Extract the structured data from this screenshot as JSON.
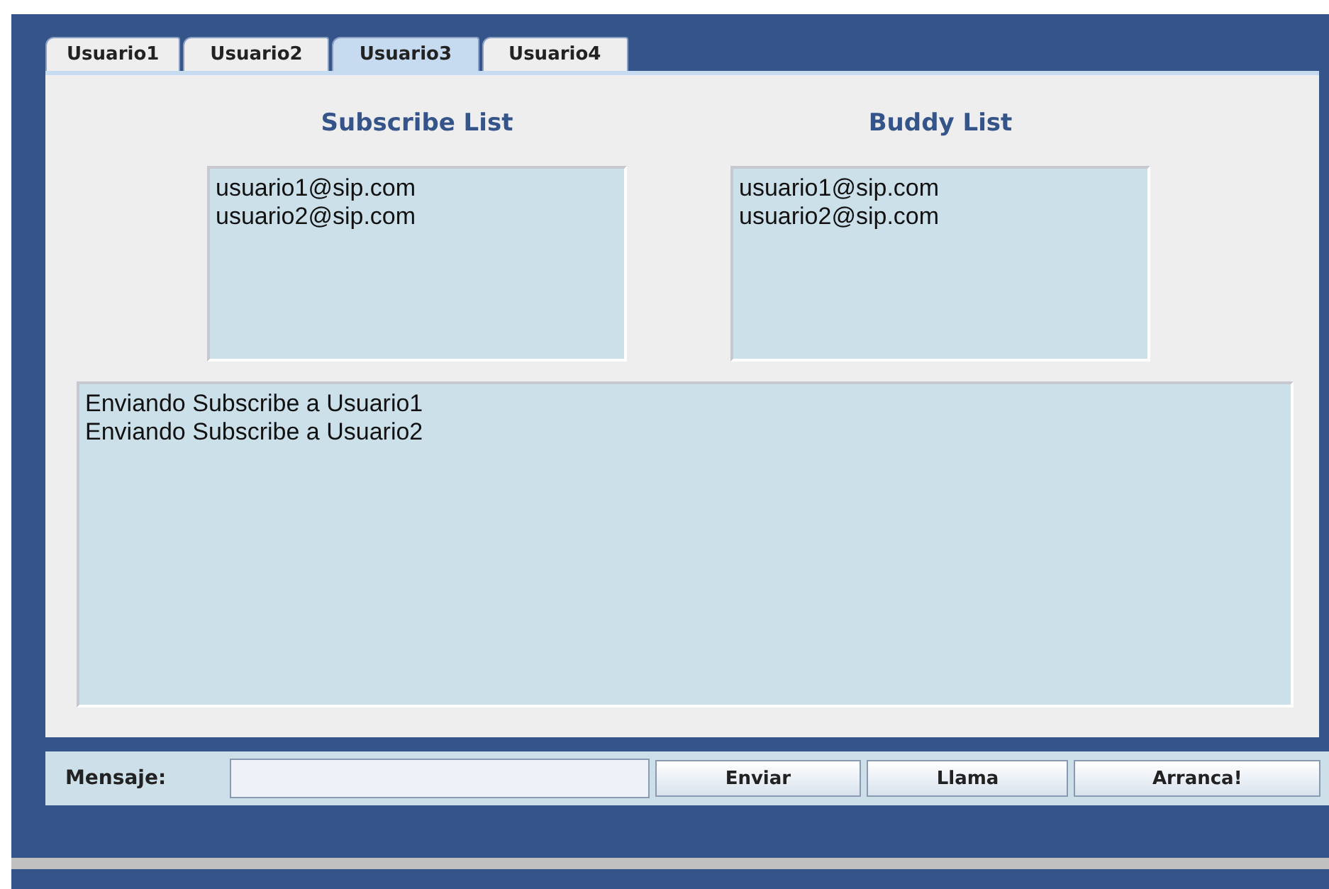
{
  "tabs": [
    {
      "label": "Usuario1",
      "selected": false
    },
    {
      "label": "Usuario2",
      "selected": false
    },
    {
      "label": "Usuario3",
      "selected": true
    },
    {
      "label": "Usuario4",
      "selected": false
    }
  ],
  "subscribe_list": {
    "title": "Subscribe List",
    "items": [
      "usuario1@sip.com",
      "usuario2@sip.com"
    ]
  },
  "buddy_list": {
    "title": "Buddy List",
    "items": [
      "usuario1@sip.com",
      "usuario2@sip.com"
    ]
  },
  "log": [
    "Enviando Subscribe a Usuario1",
    "Enviando Subscribe a Usuario2"
  ],
  "message_bar": {
    "label": "Mensaje:",
    "buttons": [
      "Enviar",
      "Llama",
      "Arranca!"
    ]
  }
}
